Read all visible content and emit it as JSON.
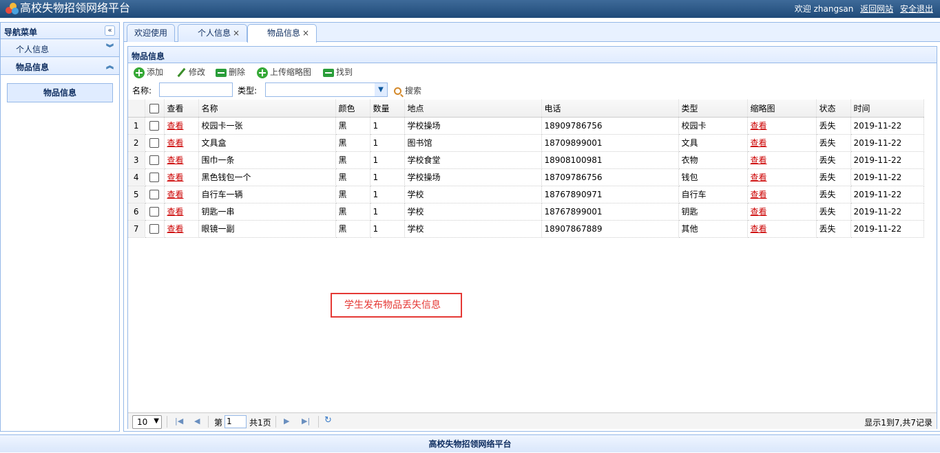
{
  "header": {
    "title": "高校失物招领网络平台",
    "welcome": "欢迎 zhangsan",
    "back_link": "返回网站",
    "logout_link": "安全退出"
  },
  "sidebar": {
    "title": "导航菜单",
    "collapse_icon": "double-chevron-left-icon",
    "sections": [
      {
        "label": "个人信息",
        "icon": "double-chevron-down-icon"
      },
      {
        "label": "物品信息",
        "icon": "double-chevron-up-icon"
      }
    ],
    "active_item": "物品信息"
  },
  "tabs": [
    {
      "label": "欢迎使用"
    },
    {
      "label": "个人信息",
      "close": "×"
    },
    {
      "label": "物品信息",
      "close": "×"
    }
  ],
  "panel": {
    "title": "物品信息",
    "toolbar": {
      "add": "添加",
      "edit": "修改",
      "delete": "删除",
      "upload": "上传缩略图",
      "found": "找到"
    },
    "search": {
      "name_label": "名称:",
      "name_value": "",
      "type_label": "类型:",
      "type_value": "",
      "search_button": "搜索"
    }
  },
  "grid": {
    "columns": [
      "查看",
      "名称",
      "颜色",
      "数量",
      "地点",
      "电话",
      "类型",
      "缩略图",
      "状态",
      "时间"
    ],
    "rows": [
      {
        "n": "1",
        "view": "查看",
        "name": "校园卡一张",
        "color": "黑",
        "qty": "1",
        "place": "学校操场",
        "phone": "18909786756",
        "type": "校园卡",
        "thumb": "查看",
        "status": "丢失",
        "time": "2019-11-22"
      },
      {
        "n": "2",
        "view": "查看",
        "name": "文具盒",
        "color": "黑",
        "qty": "1",
        "place": "图书馆",
        "phone": "18709899001",
        "type": "文具",
        "thumb": "查看",
        "status": "丢失",
        "time": "2019-11-22"
      },
      {
        "n": "3",
        "view": "查看",
        "name": "围巾一条",
        "color": "黑",
        "qty": "1",
        "place": "学校食堂",
        "phone": "18908100981",
        "type": "衣物",
        "thumb": "查看",
        "status": "丢失",
        "time": "2019-11-22"
      },
      {
        "n": "4",
        "view": "查看",
        "name": "黑色钱包一个",
        "color": "黑",
        "qty": "1",
        "place": "学校操场",
        "phone": "18709786756",
        "type": "钱包",
        "thumb": "查看",
        "status": "丢失",
        "time": "2019-11-22"
      },
      {
        "n": "5",
        "view": "查看",
        "name": "自行车一辆",
        "color": "黑",
        "qty": "1",
        "place": "学校",
        "phone": "18767890971",
        "type": "自行车",
        "thumb": "查看",
        "status": "丢失",
        "time": "2019-11-22"
      },
      {
        "n": "6",
        "view": "查看",
        "name": "钥匙一串",
        "color": "黑",
        "qty": "1",
        "place": "学校",
        "phone": "18767899001",
        "type": "钥匙",
        "thumb": "查看",
        "status": "丢失",
        "time": "2019-11-22"
      },
      {
        "n": "7",
        "view": "查看",
        "name": "眼镜一副",
        "color": "黑",
        "qty": "1",
        "place": "学校",
        "phone": "18907867889",
        "type": "其他",
        "thumb": "查看",
        "status": "丢失",
        "time": "2019-11-22"
      }
    ]
  },
  "annotation": "学生发布物品丢失信息",
  "pager": {
    "page_size": "10",
    "page_prefix": "第",
    "page_value": "1",
    "page_total": "共1页",
    "summary": "显示1到7,共7记录"
  },
  "footer": "高校失物招领网络平台",
  "colors": {
    "accent": "#95b8e7",
    "header": "#1f4a78",
    "link": "#cc0000",
    "annotation": "#e53935"
  }
}
